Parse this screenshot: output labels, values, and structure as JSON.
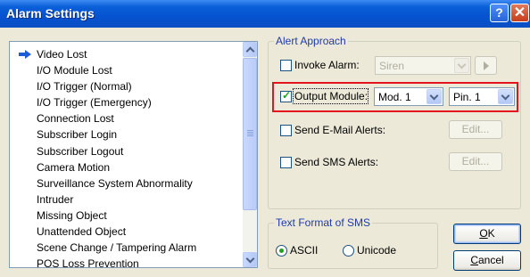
{
  "window": {
    "title": "Alarm Settings",
    "help_label": "?",
    "close_label": "✕"
  },
  "events": {
    "items": [
      {
        "label": "Video Lost",
        "selected": true
      },
      {
        "label": "I/O Module Lost"
      },
      {
        "label": "I/O Trigger (Normal)"
      },
      {
        "label": "I/O Trigger (Emergency)"
      },
      {
        "label": "Connection Lost"
      },
      {
        "label": "Subscriber Login"
      },
      {
        "label": "Subscriber Logout"
      },
      {
        "label": "Camera Motion"
      },
      {
        "label": "Surveillance System Abnormality"
      },
      {
        "label": "Intruder"
      },
      {
        "label": "Missing Object"
      },
      {
        "label": "Unattended Object"
      },
      {
        "label": "Scene Change / Tampering Alarm"
      },
      {
        "label": "POS Loss Prevention"
      }
    ]
  },
  "alert_approach": {
    "legend": "Alert Approach",
    "invoke_alarm": {
      "label": "Invoke Alarm:",
      "checked": false,
      "sound": "Siren",
      "enabled": false
    },
    "output_module": {
      "label": "Output Module:",
      "checked": true,
      "module": "Mod. 1",
      "pin": "Pin. 1"
    },
    "email": {
      "label": "Send E-Mail Alerts:",
      "checked": false,
      "button": "Edit..."
    },
    "sms": {
      "label": "Send SMS Alerts:",
      "checked": false,
      "button": "Edit..."
    }
  },
  "sms_format": {
    "legend": "Text Format of SMS",
    "options": [
      {
        "label": "ASCII",
        "checked": true
      },
      {
        "label": "Unicode",
        "checked": false
      }
    ]
  },
  "buttons": {
    "ok_first": "O",
    "ok_rest": "K",
    "cancel_first": "C",
    "cancel_rest": "ancel"
  },
  "colors": {
    "title_bar": "#0A5FD8",
    "highlight_box": "#E3141C",
    "group_legend": "#1F3BAA"
  }
}
